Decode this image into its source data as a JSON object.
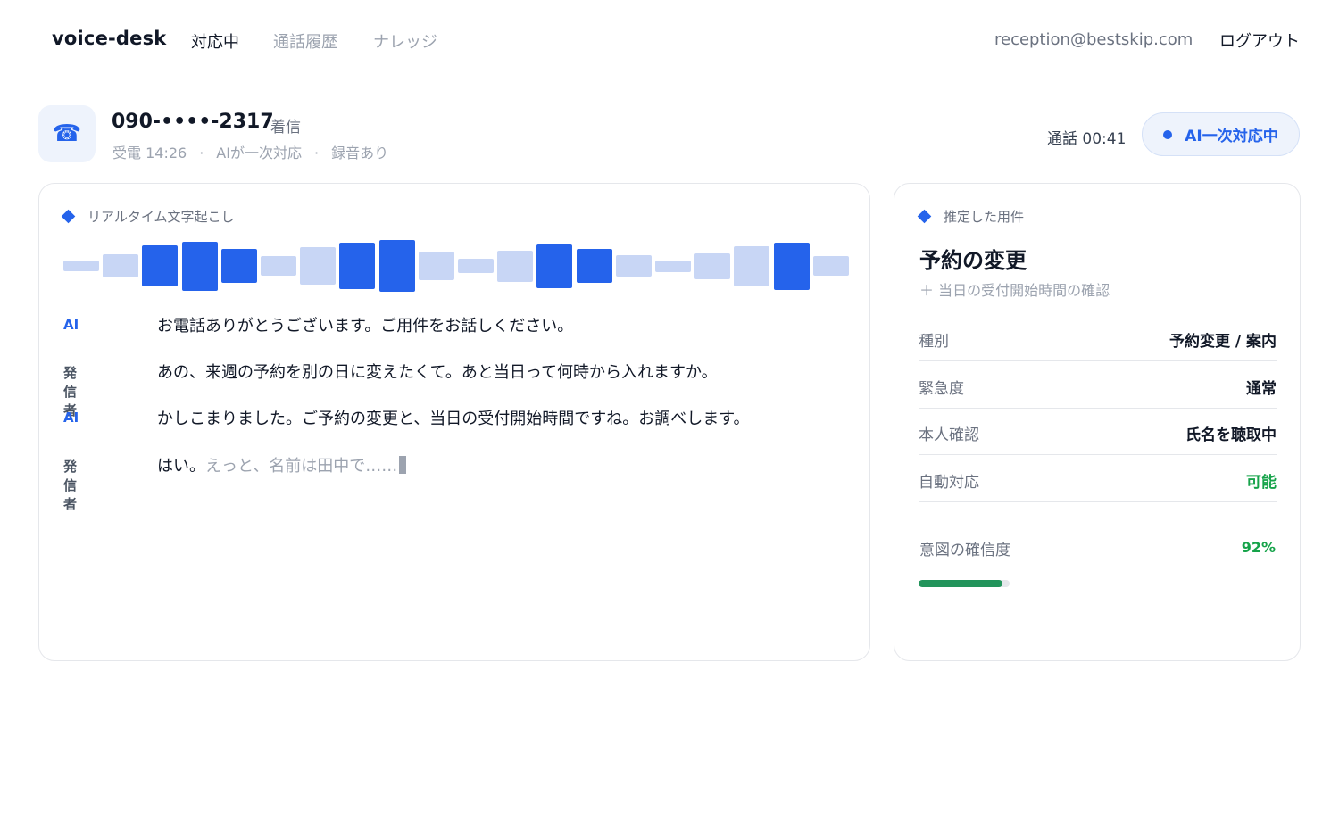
{
  "app": {
    "name": "voice-desk"
  },
  "nav": {
    "active": "対応中",
    "history": "通話履歴",
    "knowledge": "ナレッジ"
  },
  "user": {
    "email": "reception@bestskip.com",
    "logout": "ログアウト"
  },
  "call": {
    "icon": "phone-icon",
    "icon_glyph": "☎",
    "number": "090-••••-2317",
    "direction": "着信",
    "received": "受電 14:26",
    "handler": "AIが一次対応",
    "recording": "録音あり",
    "separator": "·",
    "duration": "通話 00:41",
    "status": "AI一次対応中"
  },
  "transcript": {
    "label": "リアルタイム文字起こし",
    "waveform_levels": [
      0.2,
      0.45,
      0.8,
      0.95,
      0.65,
      0.38,
      0.72,
      0.9,
      1.0,
      0.55,
      0.28,
      0.6,
      0.85,
      0.65,
      0.42,
      0.22,
      0.5,
      0.78,
      0.92,
      0.38
    ],
    "waveform_active": [
      false,
      false,
      true,
      true,
      true,
      false,
      false,
      true,
      true,
      false,
      false,
      false,
      true,
      true,
      false,
      false,
      false,
      false,
      true,
      false
    ],
    "lines": [
      {
        "speaker": "AI",
        "is_ai": true,
        "text": "お電話ありがとうございます。ご用件をお話しください。",
        "interim": ""
      },
      {
        "speaker": "発信者",
        "is_ai": false,
        "text": "あの、来週の予約を別の日に変えたくて。あと当日って何時から入れますか。",
        "interim": ""
      },
      {
        "speaker": "AI",
        "is_ai": true,
        "text": "かしこまりました。ご予約の変更と、当日の受付開始時間ですね。お調べします。",
        "interim": ""
      },
      {
        "speaker": "発信者",
        "is_ai": false,
        "text": "はい。",
        "interim": "えっと、名前は田中で……"
      }
    ]
  },
  "intent": {
    "label": "推定した用件",
    "title": "予約の変更",
    "sub": "＋ 当日の受付開始時間の確認",
    "rows": [
      {
        "key": "種別",
        "value": "予約変更 / 案内",
        "ok": false
      },
      {
        "key": "緊急度",
        "value": "通常",
        "ok": false
      },
      {
        "key": "本人確認",
        "value": "氏名を聴取中",
        "ok": false
      },
      {
        "key": "自動対応",
        "value": "可能",
        "ok": true
      }
    ],
    "confidence_label": "意図の確信度",
    "confidence_text": "92%",
    "confidence": 0.92
  },
  "colors": {
    "accent": "#2563eb",
    "accent_light": "#c8d6f5",
    "success": "#16a34a"
  }
}
